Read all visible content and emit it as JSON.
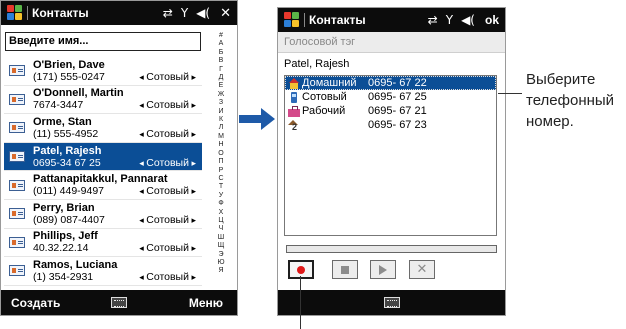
{
  "colors": {
    "titlebar": "#0c0c0c",
    "selection": "#0b4e96",
    "accent_arrow": "#1e5aa8",
    "record": "#e01818"
  },
  "left_screen": {
    "title": "Контакты",
    "status_icons": {
      "sync": "⇄",
      "signal": "Y",
      "speaker": "◀(",
      "close": "✕"
    },
    "search_placeholder": "Введите имя...",
    "alphabet": [
      "#",
      "А",
      "Б",
      "В",
      "Г",
      "Д",
      "Е",
      "Ж",
      "З",
      "И",
      "К",
      "Л",
      "М",
      "Н",
      "О",
      "П",
      "Р",
      "С",
      "Т",
      "У",
      "Ф",
      "Х",
      "Ц",
      "Ч",
      "Ш",
      "Щ",
      "Э",
      "Ю",
      "Я"
    ],
    "contacts": [
      {
        "name": "O'Brien, Dave",
        "phone": "(171) 555-0247",
        "type": "Сотовый"
      },
      {
        "name": "O'Donnell, Martin",
        "phone": "7674-3447",
        "type": "Сотовый"
      },
      {
        "name": "Orme, Stan",
        "phone": "(11) 555-4952",
        "type": "Сотовый"
      },
      {
        "name": "Patel, Rajesh",
        "phone": "0695-34 67 25",
        "type": "Сотовый"
      },
      {
        "name": "Pattanapitakkul, Pannarat",
        "phone": "(011) 449-9497",
        "type": "Сотовый"
      },
      {
        "name": "Perry, Brian",
        "phone": "(089) 087-4407",
        "type": "Сотовый"
      },
      {
        "name": "Phillips, Jeff",
        "phone": "40.32.22.14",
        "type": "Сотовый"
      },
      {
        "name": "Ramos, Luciana",
        "phone": "(1) 354-2931",
        "type": "Сотовый"
      }
    ],
    "selected_contact": 3,
    "softkey_left": "Создать",
    "softkey_right": "Меню",
    "keyboard_icon": "keyboard-icon"
  },
  "right_screen": {
    "title": "Контакты",
    "status_icons": {
      "sync": "⇄",
      "signal": "Y",
      "speaker": "◀(",
      "ok": "ok"
    },
    "subheader": "Голосовой тэг",
    "contact_name": "Patel, Rajesh",
    "numbers": [
      {
        "type": "Домашний",
        "number": "0695- 67 22",
        "icon": "home-icon"
      },
      {
        "type": "Сотовый",
        "number": "0695- 67 25",
        "icon": "mobile-icon"
      },
      {
        "type": "Рабочий",
        "number": "0695- 67 21",
        "icon": "work-icon"
      },
      {
        "type": "",
        "number": "0695- 67 23",
        "icon": "home2-icon"
      }
    ],
    "selected_number": 0,
    "progress": 0,
    "controls": [
      "record-icon",
      "stop-icon",
      "play-icon",
      "delete-icon"
    ],
    "keyboard_icon": "keyboard-icon"
  },
  "callout_text": "Выберите\nтелефонный\nномер."
}
